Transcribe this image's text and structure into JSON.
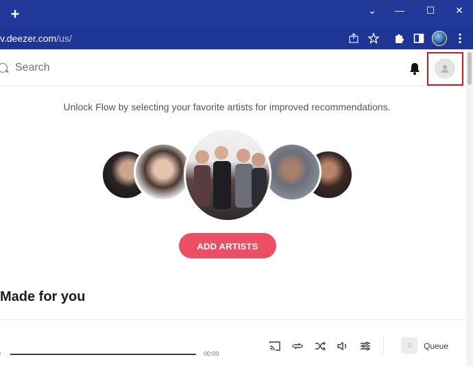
{
  "browser": {
    "new_tab_label": "+",
    "url_prefix": "v.deezer.com",
    "url_path": "/us/",
    "controls": {
      "minimize": "—",
      "maximize": "☐",
      "close": "✕",
      "dropdown": "⌄"
    },
    "toolbar_icons": [
      "share-icon",
      "star-icon",
      "puzzle-icon",
      "sidebar-icon",
      "profile-icon",
      "kebab-menu-icon"
    ]
  },
  "header": {
    "search_placeholder": "Search",
    "notification_icon": "bell-icon",
    "avatar_icon": "user-avatar-icon"
  },
  "flow": {
    "prompt": "Unlock Flow by selecting your favorite artists for improved recommendations.",
    "cta_label": "ADD ARTISTS",
    "artists": [
      "artist-1",
      "artist-2",
      "artist-3",
      "artist-4",
      "artist-5"
    ]
  },
  "sections": {
    "made_for_you": "Made for you"
  },
  "player": {
    "time_elapsed": "0",
    "time_total": "00:00",
    "queue_label": "Queue",
    "control_icons": [
      "cast-icon",
      "repeat-icon",
      "shuffle-icon",
      "volume-icon",
      "equalizer-icon"
    ]
  },
  "colors": {
    "browser_bar": "#213a9a",
    "address_bar": "#1d3594",
    "cta": "#ee4e63",
    "highlight_frame": "#d8141b"
  }
}
